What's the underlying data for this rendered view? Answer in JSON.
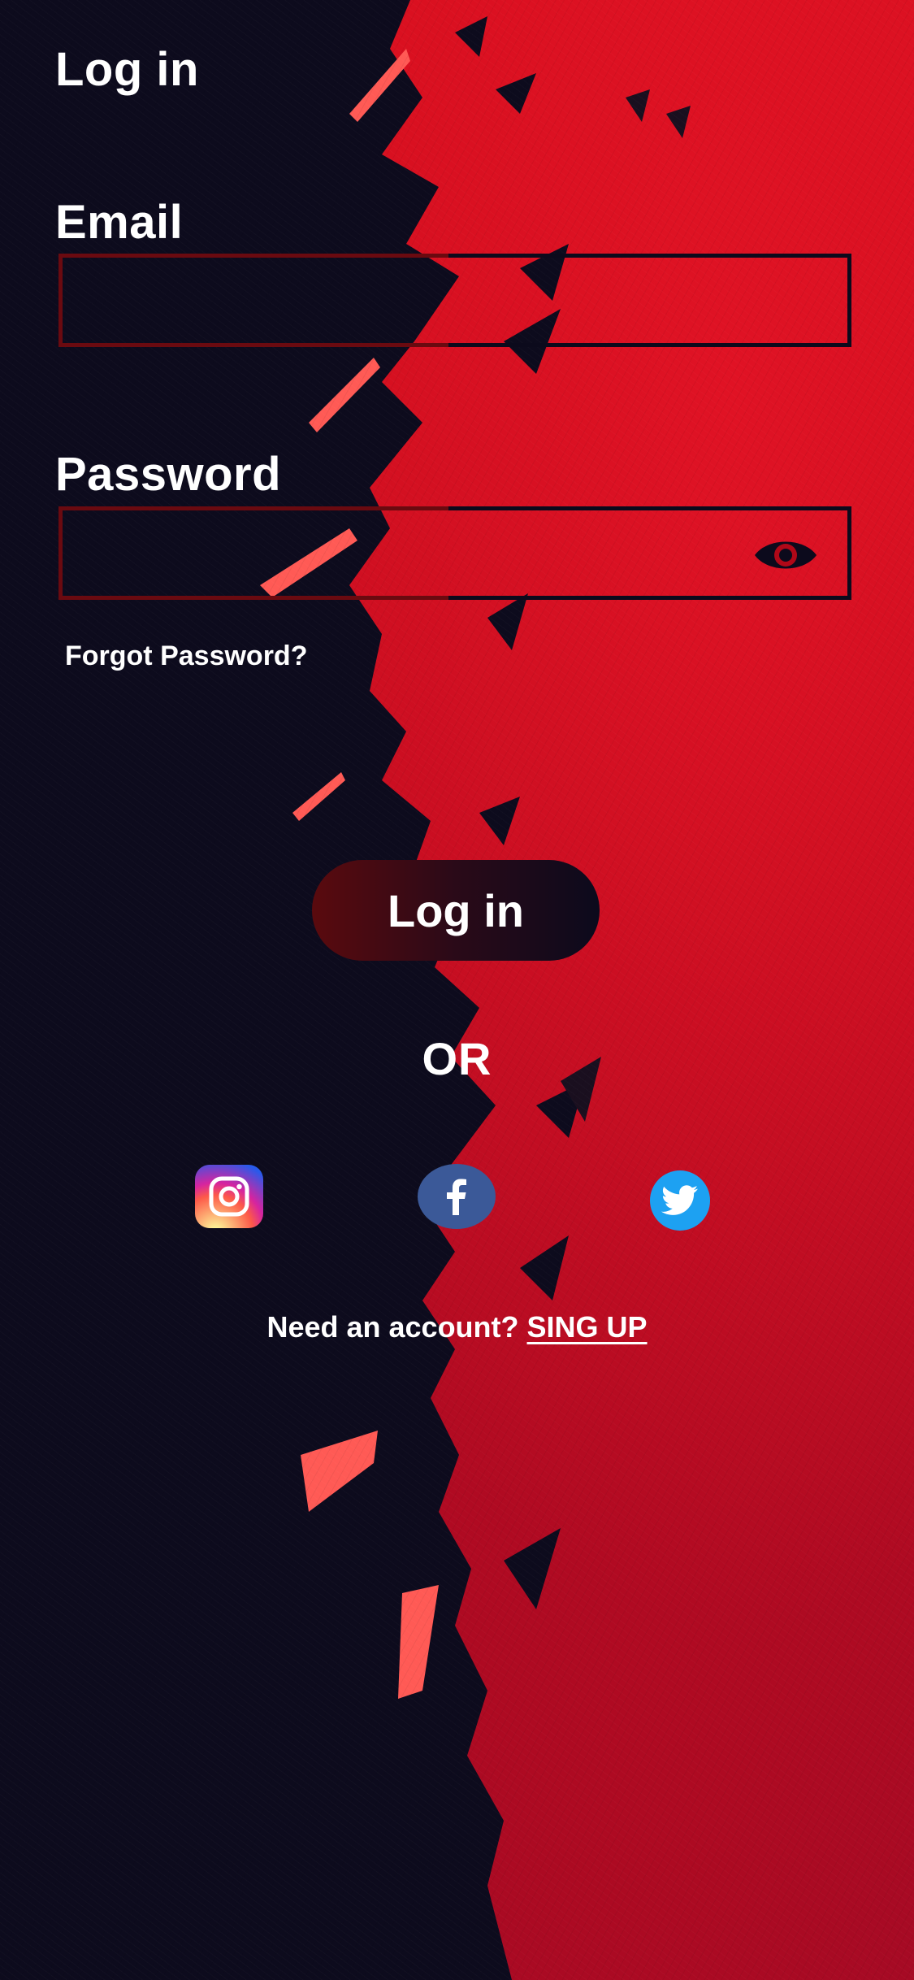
{
  "header": {
    "title": "Log in"
  },
  "form": {
    "email_label": "Email",
    "email_value": "",
    "email_placeholder": "",
    "password_label": "Password",
    "password_value": "",
    "password_placeholder": "",
    "show_password_icon": "eye-icon",
    "forgot_label": "Forgot Password?",
    "submit_label": "Log in"
  },
  "divider": {
    "label": "OR"
  },
  "social": {
    "items": [
      {
        "name": "instagram",
        "icon": "instagram-icon",
        "color": "#d6249f"
      },
      {
        "name": "facebook",
        "icon": "facebook-icon",
        "color": "#3b5998"
      },
      {
        "name": "twitter",
        "icon": "twitter-icon",
        "color": "#1da1f2"
      }
    ]
  },
  "footer": {
    "prompt": "Need an account?",
    "signup_label": "SING UP"
  },
  "colors": {
    "accent_red": "#c90e1c",
    "dark": "#0c0a1c",
    "text": "#ffffff"
  }
}
